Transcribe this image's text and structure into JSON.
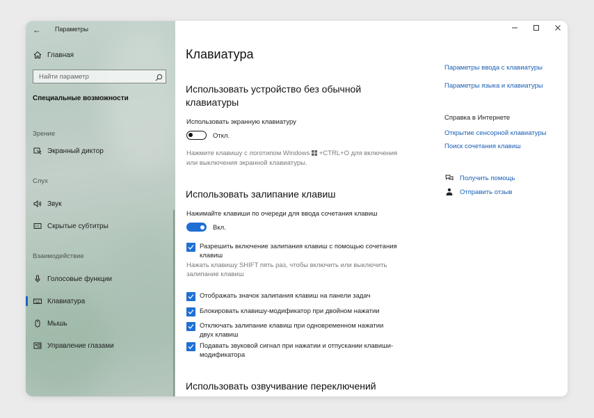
{
  "app": {
    "title": "Параметры"
  },
  "window_controls": {
    "minimize": "—",
    "maximize": "☐",
    "close": "✕"
  },
  "sidebar": {
    "home": "Главная",
    "search_placeholder": "Найти параметр",
    "category": "Специальные возможности",
    "sections": {
      "vision": "Зрение",
      "hearing": "Слух",
      "interaction": "Взаимодействие"
    },
    "items": {
      "narrator": "Экранный диктор",
      "audio": "Звук",
      "captions": "Скрытые субтитры",
      "speech": "Голосовые функции",
      "keyboard": "Клавиатура",
      "mouse": "Мышь",
      "eye_control": "Управление глазами"
    }
  },
  "main": {
    "title": "Клавиатура",
    "onscreen": {
      "heading_line1": "Использовать устройство без обычной",
      "heading_line2": "клавиатуры",
      "toggle_label": "Использовать экранную клавиатуру",
      "toggle_state": "Откл.",
      "hint_part1": "Нажмите клавишу с логотипом Windows",
      "hint_part2": "+CTRL+O для включения",
      "hint_line2": "или выключения экранной клавиатуры."
    },
    "sticky": {
      "heading": "Использовать залипание клавиш",
      "toggle_label": "Нажимайте клавиши по очереди для ввода сочетания клавиш",
      "toggle_state": "Вкл.",
      "shortcut_line1": "Разрешить включение залипания клавиш с помощью сочетания",
      "shortcut_line2": "клавиш",
      "shortcut_hint_line1": "Нажать клавишу SHIFT пять раз, чтобы включить или выключить",
      "shortcut_hint_line2": "залипание клавиш",
      "taskbar_icon": "Отображать значок залипания клавиш на панели задач",
      "lock_modifier": "Блокировать клавишу-модификатор при двойном нажатии",
      "disable_line1": "Отключать залипание клавиш при одновременном нажатии",
      "disable_line2": "двух клавиш",
      "sound_line1": "Подавать звуковой сигнал при нажатии и отпускании клавиши-",
      "sound_line2": "модификатора"
    },
    "toggle_keys": {
      "heading": "Использовать озвучивание переключений"
    }
  },
  "related": {
    "link1": "Параметры ввода с клавиатуры",
    "link2": "Параметры языка и клавиатуры",
    "help_heading": "Справка в Интернете",
    "help_link1": "Открытие сенсорной клавиатуры",
    "help_link2": "Поиск сочетания клавиш",
    "get_help": "Получить помощь",
    "feedback": "Отправить отзыв"
  },
  "colors": {
    "accent": "#1f6fd4",
    "link": "#1a5fb4"
  },
  "icons": [
    "back-arrow-icon",
    "home-icon",
    "search-icon",
    "narrator-icon",
    "speaker-icon",
    "captions-icon",
    "microphone-icon",
    "keyboard-icon",
    "mouse-icon",
    "eye-control-icon",
    "windows-logo-icon",
    "checkmark-icon",
    "help-icon",
    "feedback-icon"
  ]
}
